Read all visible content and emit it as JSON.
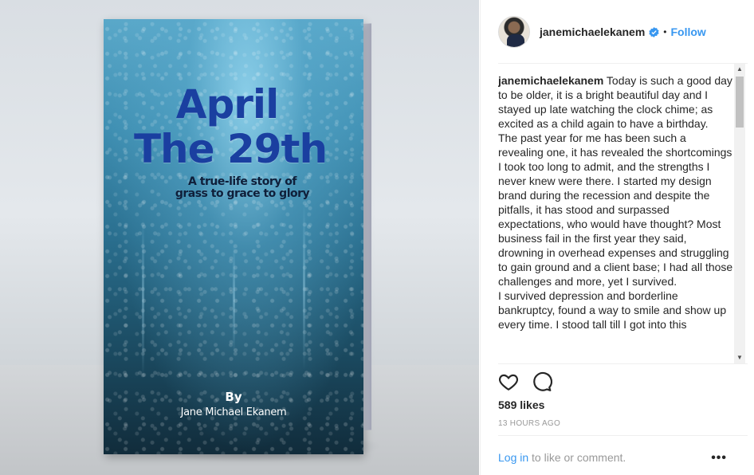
{
  "book": {
    "title_line1": "April",
    "title_line2": "The 29th",
    "subtitle_line1": "A true-life story of",
    "subtitle_line2": "grass to grace to glory",
    "by": "By",
    "author": "Jane Michael Ekanem"
  },
  "post": {
    "username": "janemichaelekanem",
    "separator": "•",
    "follow_label": "Follow",
    "caption_username": "janemichaelekanem",
    "caption_text": " Today is such a good day to be older, it is a bright beautiful day and I stayed up late watching the clock chime; as excited as a child again to have a birthday.\nThe past year for me has been such a revealing one, it has revealed the shortcomings I took too long to admit, and the strengths I never knew were there. I started my design brand during the recession and despite the pitfalls, it has stood and surpassed expectations, who would have thought? Most business fail in the first year they said, drowning in overhead expenses and struggling to gain ground and a client base; I had all those challenges and more, yet I survived.\nI survived depression and borderline bankruptcy, found a way to smile and show up every time. I stood tall till I got into this",
    "likes": "589 likes",
    "time": "13 HOURS AGO",
    "login_link": "Log in",
    "login_rest": " to like or comment.",
    "more_label": "•••"
  },
  "colors": {
    "link": "#3897f0",
    "verified": "#3897f0",
    "muted": "#999999"
  },
  "icons": {
    "verified": "verified-badge-icon",
    "like": "heart-icon",
    "comment": "comment-bubble-icon",
    "more": "more-options-icon"
  }
}
